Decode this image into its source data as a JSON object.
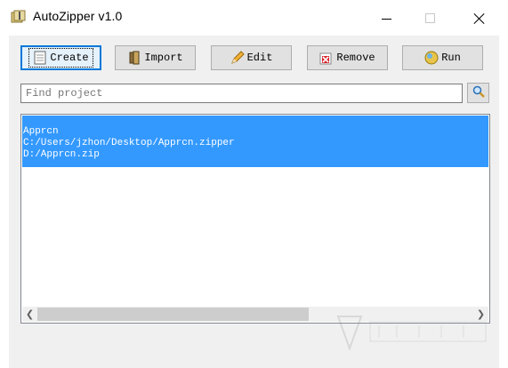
{
  "window": {
    "title": "AutoZipper v1.0"
  },
  "toolbar": {
    "create_label": "Create",
    "import_label": "Import",
    "edit_label": "Edit",
    "remove_label": "Remove",
    "run_label": "Run"
  },
  "search": {
    "placeholder": "Find project",
    "value": ""
  },
  "projects": [
    {
      "name": "Apprcn",
      "source": "C:/Users/jzhon/Desktop/Apprcn.zipper",
      "target": "D:/Apprcn.zip",
      "selected": true
    }
  ],
  "colors": {
    "selection": "#3399ff",
    "default_button_border": "#0078d7"
  }
}
